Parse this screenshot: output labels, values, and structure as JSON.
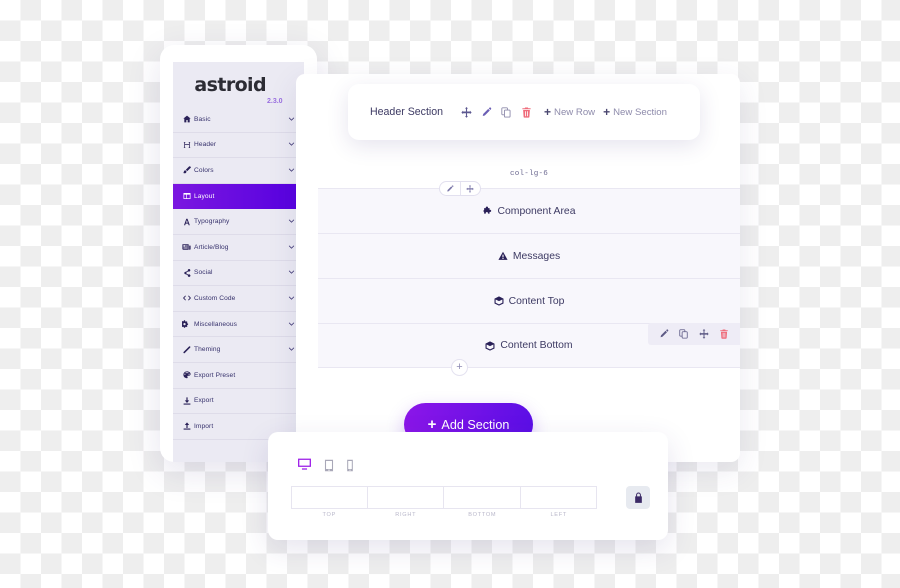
{
  "sidebar": {
    "logo": "astroid",
    "version": "2.3.0",
    "items": [
      {
        "label": "Basic",
        "icon": "home-icon",
        "caret": true,
        "active": false
      },
      {
        "label": "Header",
        "icon": "heading-icon",
        "caret": true,
        "active": false
      },
      {
        "label": "Colors",
        "icon": "brush-icon",
        "caret": true,
        "active": false
      },
      {
        "label": "Layout",
        "icon": "layout-icon",
        "caret": false,
        "active": true
      },
      {
        "label": "Typography",
        "icon": "font-icon",
        "caret": true,
        "active": false
      },
      {
        "label": "Article/Blog",
        "icon": "newspaper-icon",
        "caret": true,
        "active": false
      },
      {
        "label": "Social",
        "icon": "share-icon",
        "caret": true,
        "active": false
      },
      {
        "label": "Custom Code",
        "icon": "code-icon",
        "caret": true,
        "active": false
      },
      {
        "label": "Miscellaneous",
        "icon": "cogs-icon",
        "caret": true,
        "active": false
      },
      {
        "label": "Theming",
        "icon": "magic-wand-icon",
        "caret": true,
        "active": false
      },
      {
        "label": "Export Preset",
        "icon": "palette-icon",
        "caret": false,
        "active": false
      },
      {
        "label": "Export",
        "icon": "download-icon",
        "caret": false,
        "active": false
      },
      {
        "label": "Import",
        "icon": "upload-icon",
        "caret": false,
        "active": false
      }
    ]
  },
  "header_card": {
    "title": "Header Section",
    "tools": [
      {
        "name": "move-icon",
        "title": "Move"
      },
      {
        "name": "edit-icon",
        "title": "Edit"
      },
      {
        "name": "copy-icon",
        "title": "Duplicate"
      },
      {
        "name": "trash-icon",
        "title": "Delete"
      }
    ],
    "new_row_label": "New Row",
    "new_section_label": "New Section",
    "plus": "+"
  },
  "column": {
    "class_label": "col-lg-6",
    "pill_tools": [
      {
        "name": "edit-icon"
      },
      {
        "name": "move-icon"
      }
    ]
  },
  "rows": [
    {
      "label": "Component Area",
      "icon": "puzzle-icon",
      "toolbar": false
    },
    {
      "label": "Messages",
      "icon": "warning-icon",
      "toolbar": false
    },
    {
      "label": "Content Top",
      "icon": "cube-icon",
      "toolbar": false
    },
    {
      "label": "Content Bottom",
      "icon": "cube-icon",
      "toolbar": true
    }
  ],
  "row_toolbar": [
    {
      "name": "edit-icon"
    },
    {
      "name": "copy-icon"
    },
    {
      "name": "move-icon"
    },
    {
      "name": "trash-icon"
    }
  ],
  "row_add": {
    "label": "+",
    "name": "add-row-button"
  },
  "add_section": {
    "label": "Add Section",
    "plus": "+"
  },
  "spacing_panel": {
    "devices": [
      {
        "name": "desktop-icon",
        "active": true
      },
      {
        "name": "tablet-icon",
        "active": false
      },
      {
        "name": "mobile-icon",
        "active": false
      }
    ],
    "fields": [
      {
        "label": "TOP",
        "value": "",
        "placeholder": ""
      },
      {
        "label": "RIGHT",
        "value": "",
        "placeholder": ""
      },
      {
        "label": "BOTTOM",
        "value": "",
        "placeholder": ""
      },
      {
        "label": "LEFT",
        "value": "",
        "placeholder": ""
      }
    ],
    "lock": {
      "name": "lock-icon"
    }
  },
  "colors": {
    "accent_purple": "#5500e0",
    "accent_gradient_from": "#8c16e8",
    "accent_gradient_to": "#5a0ee6",
    "sidebar_bg": "#ebeaf3",
    "row_bg": "#f8f7fc",
    "text_dark": "#3d3a63",
    "muted": "#8e8bab",
    "danger": "#ef6b7a"
  }
}
